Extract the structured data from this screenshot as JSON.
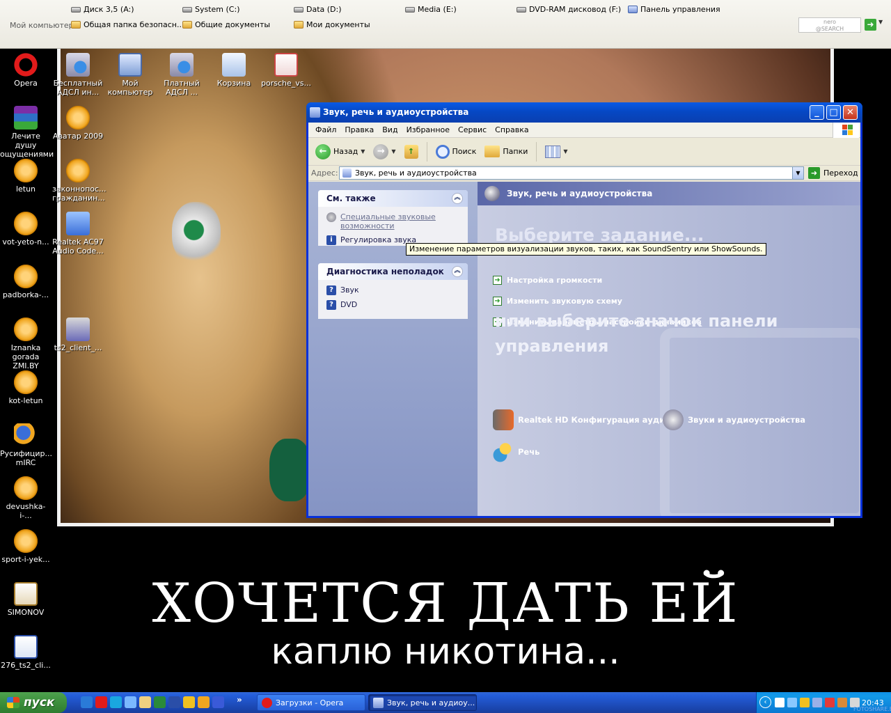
{
  "topbar": {
    "my_computer": "Мой компьютер",
    "items": [
      {
        "label": "Диск 3,5 (A:)",
        "icon": "floppy-drive-icon"
      },
      {
        "label": "System (C:)",
        "icon": "hard-drive-icon"
      },
      {
        "label": "Data (D:)",
        "icon": "hard-drive-icon"
      },
      {
        "label": "Media (E:)",
        "icon": "hard-drive-icon"
      },
      {
        "label": "DVD-RAM дисковод (F:)",
        "icon": "dvd-drive-icon"
      },
      {
        "label": "Панель управления",
        "icon": "control-panel-icon"
      },
      {
        "label": "Общая папка безопасн...",
        "icon": "folder-icon"
      },
      {
        "label": "Общие документы",
        "icon": "folder-icon"
      },
      {
        "label": "Мои документы",
        "icon": "folder-icon"
      }
    ],
    "nero_logo": "nero\n@SEARCH"
  },
  "desktop_icons": [
    {
      "label": "Opera",
      "icon": "opera-icon"
    },
    {
      "label": "Бесплатный АДСЛ ин...",
      "icon": "network-connection-icon"
    },
    {
      "label": "Мой компьютер",
      "icon": "my-computer-icon"
    },
    {
      "label": "Платный АДСЛ ...",
      "icon": "network-connection-icon"
    },
    {
      "label": "Корзина",
      "icon": "recycle-bin-icon"
    },
    {
      "label": "porsche_vs...",
      "icon": "image-file-icon"
    },
    {
      "label": "Лечите душу ощущениями",
      "icon": "winrar-icon"
    },
    {
      "label": "Аватар 2009",
      "icon": "media-file-icon"
    },
    {
      "label": "letun",
      "icon": "media-file-icon"
    },
    {
      "label": "законнопос... гражданин...",
      "icon": "media-file-icon"
    },
    {
      "label": "vot-yeto-n...",
      "icon": "media-file-icon"
    },
    {
      "label": "Realtek AC97 Audio Code...",
      "icon": "realtek-icon"
    },
    {
      "label": "padborka-...",
      "icon": "media-file-icon"
    },
    {
      "label": "Iznanka gorada ZMI.BY",
      "icon": "media-file-icon"
    },
    {
      "label": "ts2_client_...",
      "icon": "setup-icon"
    },
    {
      "label": "kot-letun",
      "icon": "media-file-icon"
    },
    {
      "label": "Русифицир... mIRC",
      "icon": "mirc-icon"
    },
    {
      "label": "devushka-i-...",
      "icon": "media-file-icon"
    },
    {
      "label": "sport-i-yek...",
      "icon": "media-file-icon"
    },
    {
      "label": "SIMONOV",
      "icon": "jpg-file-icon"
    },
    {
      "label": "276_ts2_cli...",
      "icon": "document-icon"
    }
  ],
  "wallpaper": {
    "caption_line1": "ХОЧЕТСЯ ДАТЬ ЕЙ",
    "caption_line2": "каплю никотина..."
  },
  "window": {
    "title": "Звук, речь и аудиоустройства",
    "menu": [
      "Файл",
      "Правка",
      "Вид",
      "Избранное",
      "Сервис",
      "Справка"
    ],
    "toolbar": {
      "back": "Назад",
      "search": "Поиск",
      "folders": "Папки"
    },
    "address": {
      "label": "Адрес:",
      "value": "Звук, речь и аудиоустройства",
      "go": "Переход"
    },
    "see_also": {
      "title": "См. также",
      "links": [
        "Специальные звуковые возможности",
        "Регулировка звука"
      ]
    },
    "troubleshoot": {
      "title": "Диагностика неполадок",
      "links": [
        "Звук",
        "DVD"
      ]
    },
    "header": "Звук, речь и аудиоустройства",
    "pick_task": "Выберите задание...",
    "tasks": [
      "Настройка громкости",
      "Изменить звуковую схему",
      "Изменить параметры настройки динамиков"
    ],
    "or_pick": "или выберите значок панели управления",
    "cpl_items": [
      "Realtek HD Конфигурация аудио",
      "Звуки и аудиоустройства",
      "Речь"
    ],
    "tooltip": "Изменение параметров визуализации звуков, таких, как SoundSentry или ShowSounds."
  },
  "taskbar": {
    "start": "пуск",
    "tasks": [
      "Загрузки - Opera",
      "Звук, речь и аудиоу..."
    ],
    "clock": "20:43",
    "watermark": "FOTOSHARE.BY",
    "quick_more": "»"
  }
}
